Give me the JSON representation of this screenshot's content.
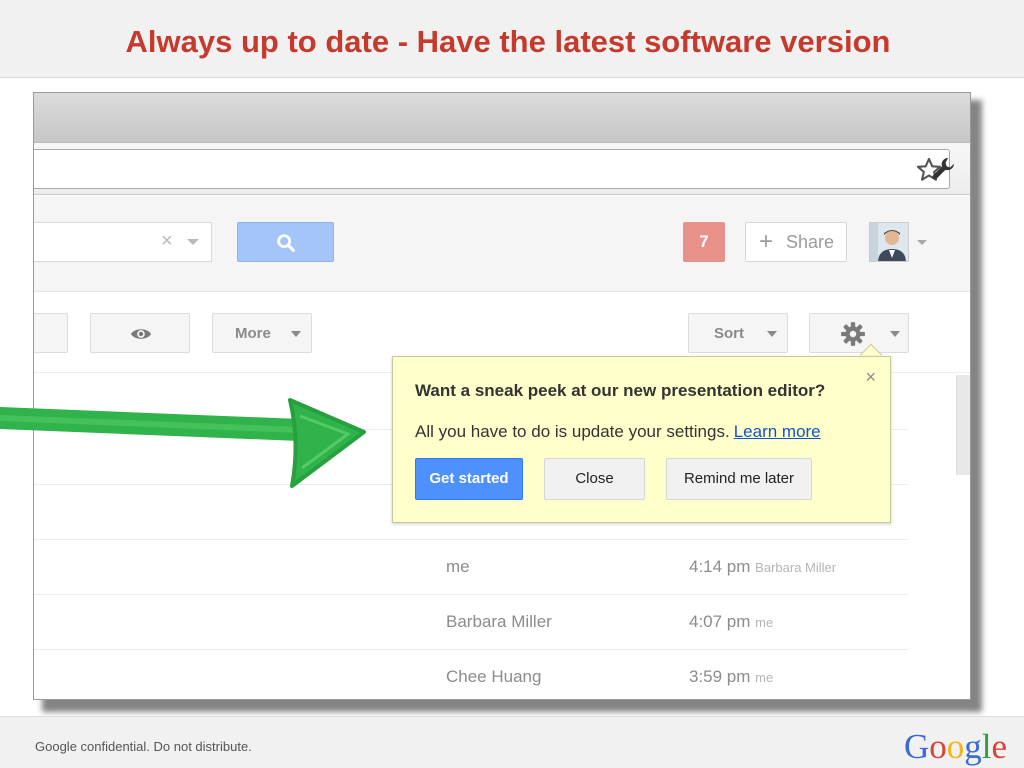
{
  "slide": {
    "title": "Always up to date - Have the latest software version",
    "footer": "Google confidential.  Do not distribute.",
    "logo_letters": [
      "G",
      "o",
      "o",
      "g",
      "l",
      "e"
    ],
    "logo_colors": [
      "#3a6bd6",
      "#d8453a",
      "#f2b51c",
      "#3a6bd6",
      "#2f9c49",
      "#d8453a"
    ]
  },
  "browser": {
    "star_icon": "star-icon",
    "wrench_icon": "wrench-icon"
  },
  "header": {
    "search_clear": "×",
    "notification_count": "7",
    "share_plus": "+",
    "share_label": "Share"
  },
  "actions": {
    "more_label": "More",
    "sort_label": "Sort"
  },
  "promo": {
    "close_x": "×",
    "title": "Want a sneak peek at our new presentation editor?",
    "body": "All you have to do is update your settings.",
    "link": "Learn more",
    "get_started": "Get started",
    "close": "Close",
    "remind": "Remind me later"
  },
  "rows": [
    {
      "sender": "me",
      "time": "4:14 pm",
      "meta": "Barbara Miller"
    },
    {
      "sender": "Barbara Miller",
      "time": "4:07 pm",
      "meta": "me"
    },
    {
      "sender": "Chee Huang",
      "time": "3:59 pm",
      "meta": "me"
    }
  ],
  "colors": {
    "title_red": "#c53a2c",
    "primary_blue": "#4d90fe",
    "promo_yellow": "#ffffcc",
    "arrow_green": "#2fb34a"
  }
}
